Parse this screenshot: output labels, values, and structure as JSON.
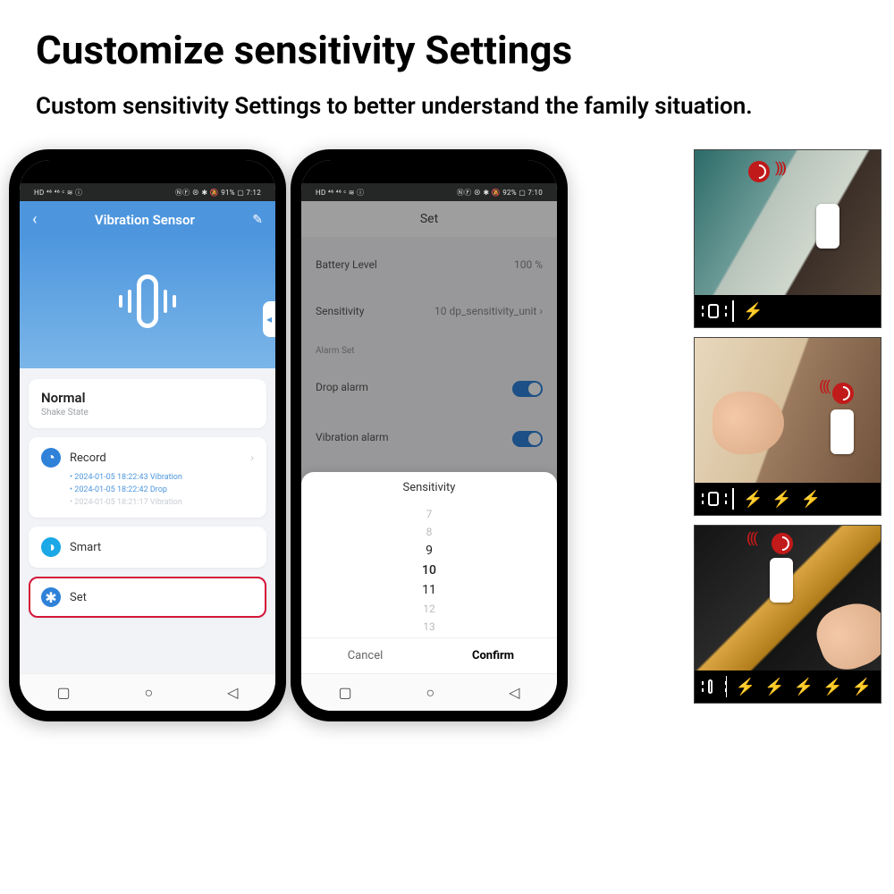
{
  "headline": "Customize sensitivity Settings",
  "subtext": "Custom sensitivity Settings to better understand the family situation.",
  "phone1": {
    "status": {
      "left": "HD ⁴⁶ ⁴⁶ ᶜ ≋ ⓘ",
      "right": "ⓃⒻ ⊗ ✱ 🔕 91% ▢ 7:12"
    },
    "header_title": "Vibration Sensor",
    "state_title": "Normal",
    "state_sub": "Shake State",
    "record_label": "Record",
    "records": [
      "2024-01-05 18:22:43 Vibration",
      "2024-01-05 18:22:42 Drop",
      "2024-01-05 18:21:17 Vibration"
    ],
    "smart_label": "Smart",
    "set_label": "Set"
  },
  "phone2": {
    "status": {
      "left": "HD ⁴⁶ ⁴⁶ ᶜ ≋ ⓘ",
      "right": "ⓃⒻ ⊗ ✱ 🔕 92% ▢ 7:10"
    },
    "set_title": "Set",
    "battery_label": "Battery Level",
    "battery_value": "100 %",
    "sens_label": "Sensitivity",
    "sens_value": "10 dp_sensitivity_unit",
    "alarm_section": "Alarm Set",
    "drop_label": "Drop alarm",
    "vib_label": "Vibration alarm",
    "picker_title": "Sensitivity",
    "picker_values": [
      "7",
      "8",
      "9",
      "10",
      "11",
      "12",
      "13"
    ],
    "cancel": "Cancel",
    "confirm": "Confirm"
  },
  "thumbs": {
    "bolts": {
      "t1": 1,
      "t2": 3,
      "t3": 5
    }
  }
}
